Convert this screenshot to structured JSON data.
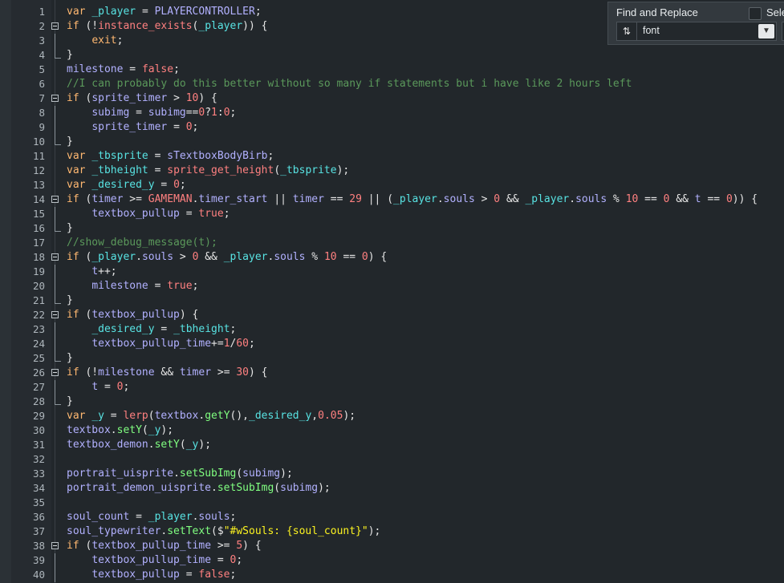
{
  "find_panel": {
    "title": "Find and Replace",
    "select_label": "Sele",
    "search_value": "font",
    "direction_icon": "up-down-arrows-icon",
    "dropdown_icon": "chevron-down-icon"
  },
  "editor": {
    "line_numbers": [
      "1",
      "2",
      "3",
      "4",
      "5",
      "6",
      "7",
      "8",
      "9",
      "10",
      "11",
      "12",
      "13",
      "14",
      "15",
      "16",
      "17",
      "18",
      "19",
      "20",
      "21",
      "22",
      "23",
      "24",
      "25",
      "26",
      "27",
      "28",
      "29",
      "30",
      "31",
      "32",
      "33",
      "34",
      "35",
      "36",
      "37",
      "38",
      "39",
      "40"
    ],
    "lines": [
      "var _player = PLAYERCONTROLLER;",
      "if (!instance_exists(_player)) {",
      "    exit;",
      "}",
      "milestone = false;",
      "//I can probably do this better without so many if statements but i have like 2 hours left",
      "if (sprite_timer > 10) {",
      "    subimg = subimg==0?1:0;",
      "    sprite_timer = 0;",
      "}",
      "var _tbsprite = sTextboxBodyBirb;",
      "var _tbheight = sprite_get_height(_tbsprite);",
      "var _desired_y = 0;",
      "if (timer >= GAMEMAN.timer_start || timer == 29 || (_player.souls > 0 && _player.souls % 10 == 0 && t == 0)) {",
      "    textbox_pullup = true;",
      "}",
      "//show_debug_message(t);",
      "if (_player.souls > 0 && _player.souls % 10 == 0) {",
      "    t++;",
      "    milestone = true;",
      "}",
      "if (textbox_pullup) {",
      "    _desired_y = _tbheight;",
      "    textbox_pullup_time+=1/60;",
      "}",
      "if (!milestone && timer >= 30) {",
      "    t = 0;",
      "}",
      "var _y = lerp(textbox.getY(),_desired_y,0.05);",
      "textbox.setY(_y);",
      "textbox_demon.setY(_y);",
      "",
      "portrait_uisprite.setSubImg(subimg);",
      "portrait_demon_uisprite.setSubImg(subimg);",
      "",
      "soul_count = _player.souls;",
      "soul_typewriter.setText($\"#wSouls: {soul_count}\");",
      "if (textbox_pullup_time >= 5) {",
      "    textbox_pullup_time = 0;",
      "    textbox_pullup = false;"
    ]
  },
  "colors": {
    "background": "#22272b",
    "keyword": "#ffb871",
    "local_var": "#58e3e3",
    "global": "#b2b1ff",
    "function": "#80ff80",
    "number": "#ff8080",
    "string": "#fcf320",
    "comment": "#5b995b"
  }
}
